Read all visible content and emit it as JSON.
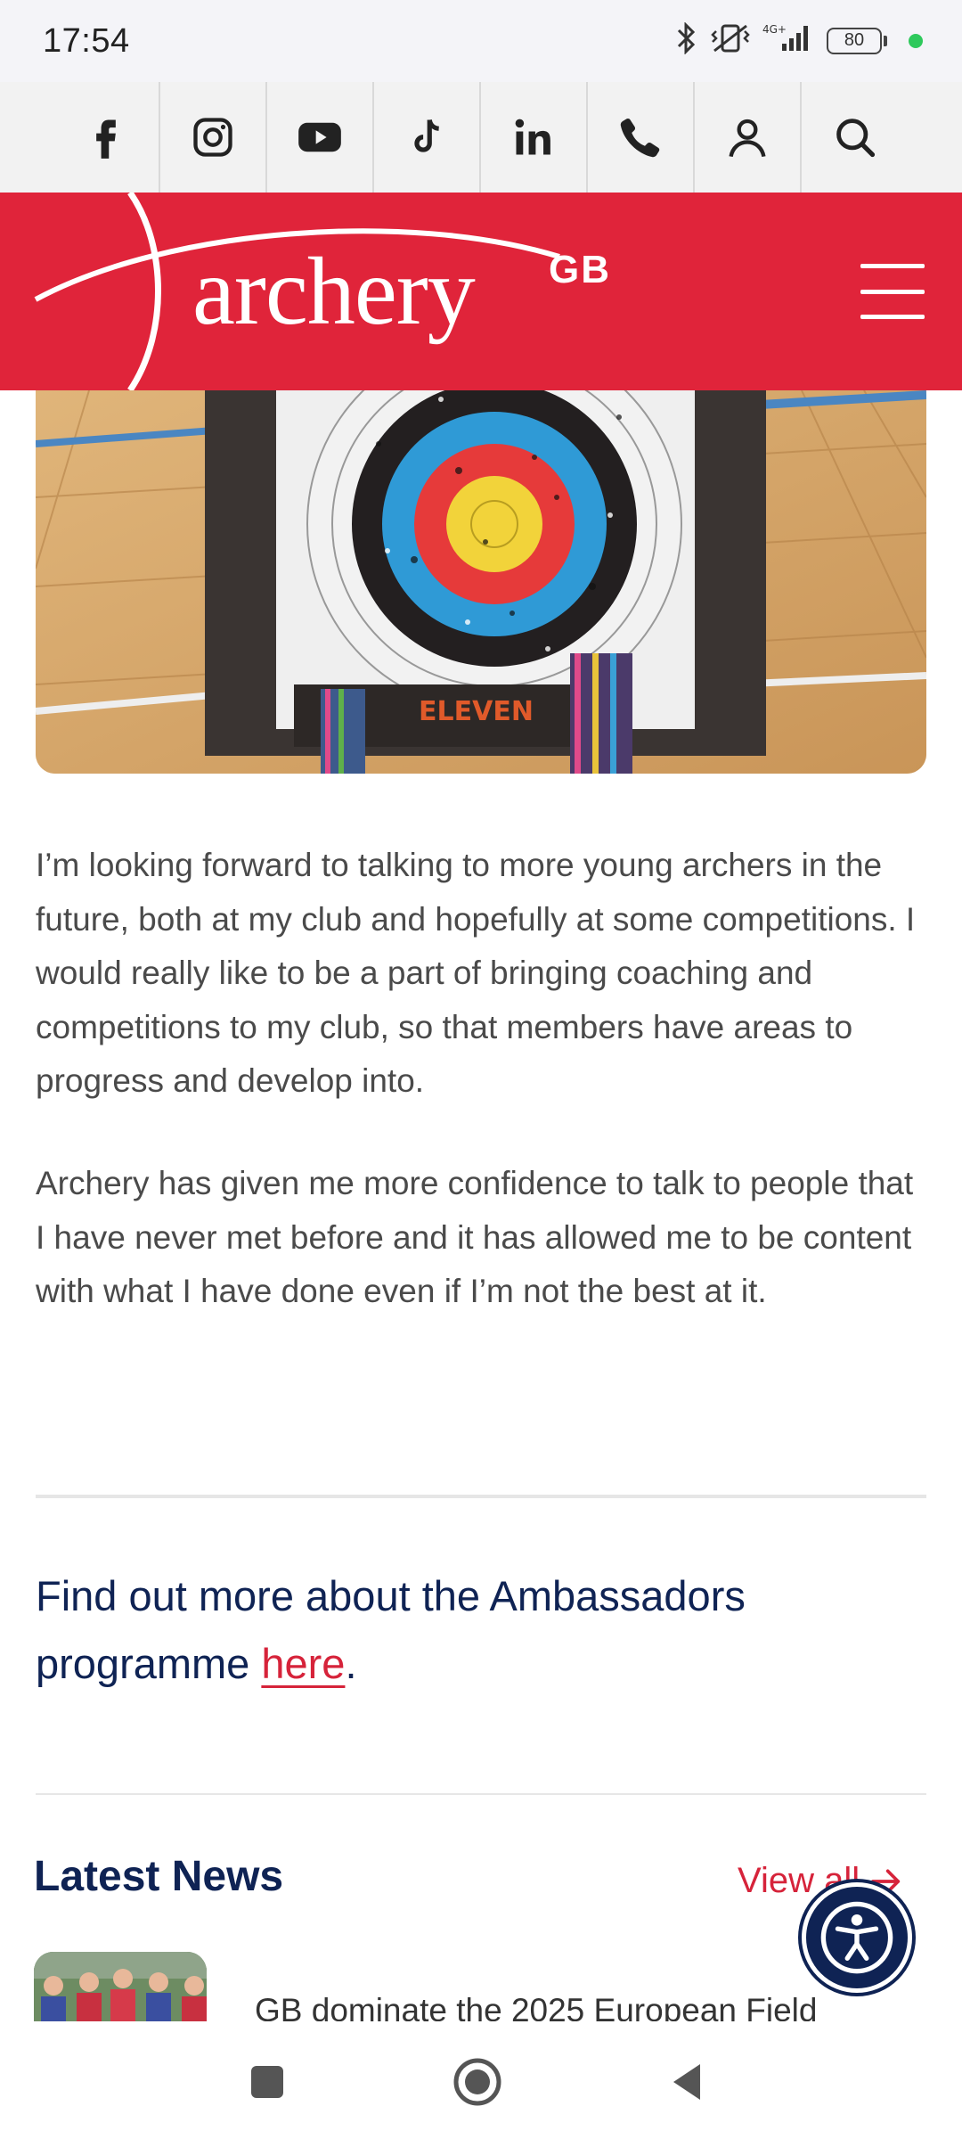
{
  "status_bar": {
    "time": "17:54",
    "network": "4G+",
    "battery": "80"
  },
  "social_bar": {
    "items": [
      {
        "icon": "facebook-icon"
      },
      {
        "icon": "instagram-icon"
      },
      {
        "icon": "youtube-icon"
      },
      {
        "icon": "tiktok-icon"
      },
      {
        "icon": "linkedin-icon"
      },
      {
        "icon": "phone-icon"
      },
      {
        "icon": "account-icon"
      },
      {
        "icon": "search-icon"
      }
    ]
  },
  "header": {
    "logo_text": "archery",
    "logo_superscript": "GB",
    "brand_color": "#e0243a"
  },
  "hero_image": {
    "target_print": "ELEVEN"
  },
  "article": {
    "paragraph_1": "I’m looking forward to talking to more young archers in the future, both at my club and hopefully at some competitions. I would really like to be a part of bringing coaching and competitions to my club, so that members have areas to progress and develop into.",
    "paragraph_2": "Archery has given me more confidence to talk to people that I have never met before and it has allowed me to be content with what I have done even if I’m not the best at it."
  },
  "cta": {
    "text_before": "Find out more about the Ambassadors programme ",
    "link_text": "here",
    "text_after": "."
  },
  "latest_news": {
    "title": "Latest News",
    "view_all": "View all",
    "items": [
      {
        "headline": "GB dominate the 2025 European Field"
      }
    ]
  },
  "colors": {
    "navy": "#0f2354",
    "red": "#d6233a"
  }
}
